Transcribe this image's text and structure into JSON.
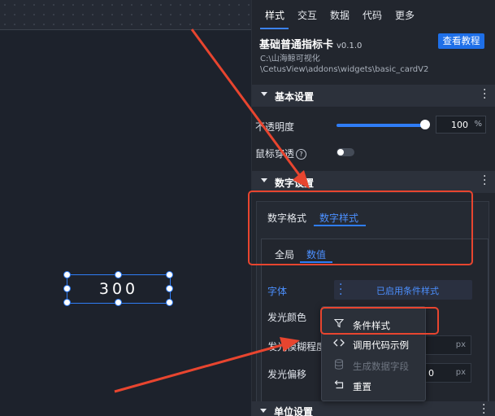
{
  "canvas": {
    "card_value": "300"
  },
  "panel": {
    "tabs": [
      "样式",
      "交互",
      "数据",
      "代码",
      "更多"
    ],
    "component_title": "基础普通指标卡",
    "version": "v0.1.0",
    "docs_button": "查看教程",
    "path_line1": "C:\\山海鲸可视化",
    "path_line2": "\\CetusView\\addons\\widgets\\basic_cardV2"
  },
  "basic_settings": {
    "header": "基本设置",
    "opacity_label": "不透明度",
    "opacity_value": "100",
    "opacity_unit": "%",
    "opacity_level": 1.0,
    "mouse_through_label": "鼠标穿透",
    "help_glyph": "?"
  },
  "number_settings": {
    "header": "数字设置",
    "subtabs": [
      "数字格式",
      "数字样式"
    ],
    "inner_tabs": [
      "全局",
      "数值"
    ],
    "font_label": "字体",
    "font_value": "已启用条件样式",
    "glow_color_label": "发光颜色",
    "glow_blur_label": "发光模糊程度",
    "glow_offset_label": "发光偏移",
    "unit_px": "px",
    "glow_offset_value": "0"
  },
  "context_menu": {
    "items": [
      {
        "label": "条件样式",
        "icon": "filter-icon",
        "disabled": false
      },
      {
        "label": "调用代码示例",
        "icon": "code-icon",
        "disabled": false
      },
      {
        "label": "生成数据字段",
        "icon": "database-icon",
        "disabled": true
      },
      {
        "label": "重置",
        "icon": "reset-icon",
        "disabled": false
      }
    ]
  },
  "unit_settings": {
    "header": "单位设置"
  },
  "colors": {
    "accent": "#2f7df6",
    "annotation": "#e8452f",
    "panel_bg": "#22262e",
    "canvas_bg": "#1d222c"
  }
}
